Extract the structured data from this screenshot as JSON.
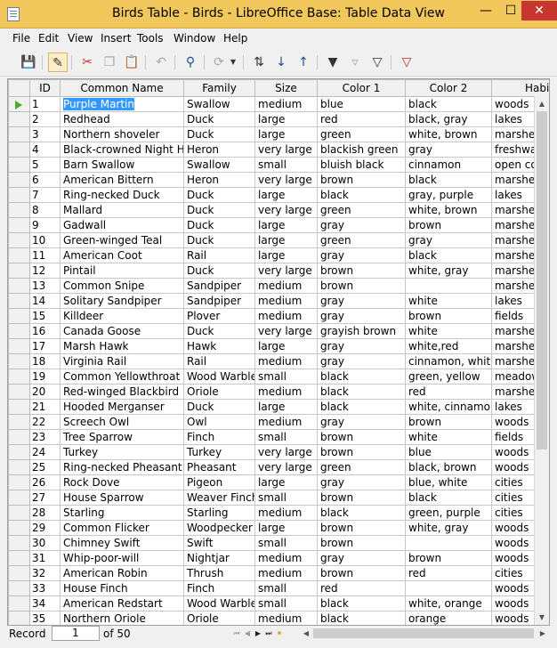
{
  "window": {
    "title": "Birds Table - Birds - LibreOffice Base: Table Data View",
    "minimize_glyph": "—",
    "maximize_glyph": "☐",
    "close_glyph": "✕"
  },
  "menu": [
    "File",
    "Edit",
    "View",
    "Insert",
    "Tools",
    "Window",
    "Help"
  ],
  "toolbar": {
    "icons": [
      "save-record-icon",
      "edit-data-icon",
      "cut-icon",
      "copy-icon",
      "paste-icon",
      "undo-icon",
      "find-record-icon",
      "refresh-icon",
      "dropdown-icon",
      "sort-icon",
      "sort-ascending-icon",
      "sort-descending-icon",
      "autofilter-icon",
      "apply-filter-icon",
      "standard-filter-icon",
      "reset-filter-icon"
    ]
  },
  "table": {
    "columns": [
      "ID",
      "Common Name",
      "Family",
      "Size",
      "Color 1",
      "Color 2",
      "Habitat"
    ],
    "current_row": 1,
    "rows": [
      [
        "1",
        "Purple Martin",
        "Swallow",
        "medium",
        "blue",
        "black",
        "woods"
      ],
      [
        "2",
        "Redhead",
        "Duck",
        "large",
        "red",
        "black, gray",
        "lakes"
      ],
      [
        "3",
        "Northern shoveler",
        "Duck",
        "large",
        "green",
        "white, brown",
        "marshes"
      ],
      [
        "4",
        "Black-crowned Night Heron",
        "Heron",
        "very large",
        "blackish green",
        "gray",
        "freshwater"
      ],
      [
        "5",
        "Barn Swallow",
        "Swallow",
        "small",
        "bluish black",
        "cinnamon",
        "open country"
      ],
      [
        "6",
        "American Bittern",
        "Heron",
        "very large",
        "brown",
        "black",
        "marshes"
      ],
      [
        "7",
        "Ring-necked Duck",
        "Duck",
        "large",
        "black",
        "gray, purple",
        "lakes"
      ],
      [
        "8",
        "Mallard",
        "Duck",
        "very large",
        "green",
        "white, brown",
        "marshes"
      ],
      [
        "9",
        "Gadwall",
        "Duck",
        "large",
        "gray",
        "brown",
        "marshes"
      ],
      [
        "10",
        "Green-winged Teal",
        "Duck",
        "large",
        "green",
        "gray",
        "marshes"
      ],
      [
        "11",
        "American Coot",
        "Rail",
        "large",
        "gray",
        "black",
        "marshes"
      ],
      [
        "12",
        "Pintail",
        "Duck",
        "very large",
        "brown",
        "white, gray",
        "marshes"
      ],
      [
        "13",
        "Common Snipe",
        "Sandpiper",
        "medium",
        "brown",
        "",
        "marshes"
      ],
      [
        "14",
        "Solitary Sandpiper",
        "Sandpiper",
        "medium",
        "gray",
        "white",
        "lakes"
      ],
      [
        "15",
        "Killdeer",
        "Plover",
        "medium",
        "gray",
        "brown",
        "fields"
      ],
      [
        "16",
        "Canada Goose",
        "Duck",
        "very large",
        "grayish brown",
        "white",
        "marshes"
      ],
      [
        "17",
        "Marsh Hawk",
        "Hawk",
        "large",
        "gray",
        "white,red",
        "marshes"
      ],
      [
        "18",
        "Virginia Rail",
        "Rail",
        "medium",
        "gray",
        "cinnamon, white",
        "marshes"
      ],
      [
        "19",
        "Common Yellowthroat",
        "Wood Warbler",
        "small",
        "black",
        "green, yellow",
        "meadows"
      ],
      [
        "20",
        "Red-winged Blackbird",
        "Oriole",
        "medium",
        "black",
        "red",
        "marshes"
      ],
      [
        "21",
        "Hooded Merganser",
        "Duck",
        "large",
        "black",
        "white, cinnamon",
        "lakes"
      ],
      [
        "22",
        "Screech Owl",
        "Owl",
        "medium",
        "gray",
        "brown",
        "woods"
      ],
      [
        "23",
        "Tree Sparrow",
        "Finch",
        "small",
        "brown",
        "white",
        "fields"
      ],
      [
        "24",
        "Turkey",
        "Turkey",
        "very large",
        "brown",
        "blue",
        "woods"
      ],
      [
        "25",
        "Ring-necked Pheasant",
        "Pheasant",
        "very large",
        "green",
        "black, brown",
        "woods"
      ],
      [
        "26",
        "Rock Dove",
        "Pigeon",
        "large",
        "gray",
        "blue, white",
        "cities"
      ],
      [
        "27",
        "House Sparrow",
        "Weaver Finch",
        "small",
        "brown",
        "black",
        "cities"
      ],
      [
        "28",
        "Starling",
        "Starling",
        "medium",
        "black",
        "green, purple",
        "cities"
      ],
      [
        "29",
        "Common Flicker",
        "Woodpecker",
        "large",
        "brown",
        "white, gray",
        "woods"
      ],
      [
        "30",
        "Chimney Swift",
        "Swift",
        "small",
        "brown",
        "",
        "woods"
      ],
      [
        "31",
        "Whip-poor-will",
        "Nightjar",
        "medium",
        "gray",
        "brown",
        "woods"
      ],
      [
        "32",
        "American Robin",
        "Thrush",
        "medium",
        "brown",
        "red",
        "cities"
      ],
      [
        "33",
        "House Finch",
        "Finch",
        "small",
        "red",
        "",
        "woods"
      ],
      [
        "34",
        "American Redstart",
        "Wood Warbler",
        "small",
        "black",
        "white, orange",
        "woods"
      ],
      [
        "35",
        "Northern Oriole",
        "Oriole",
        "medium",
        "black",
        "orange",
        "woods"
      ]
    ]
  },
  "navigation": {
    "record_label": "Record",
    "current_record": "1",
    "total_label": "of 50"
  }
}
